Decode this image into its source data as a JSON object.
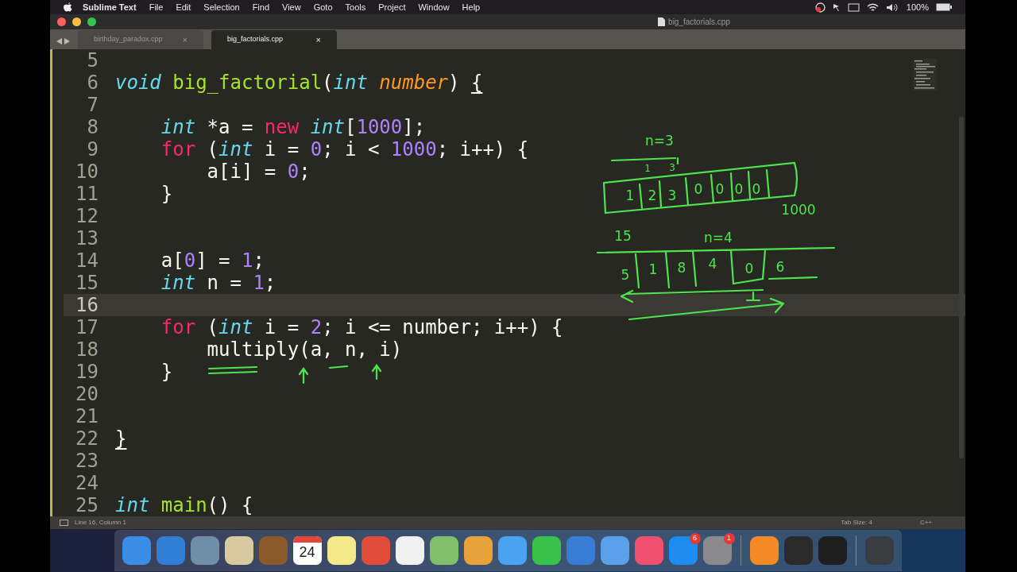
{
  "menu_bar": {
    "app": "Sublime Text",
    "items": [
      "File",
      "Edit",
      "Selection",
      "Find",
      "View",
      "Goto",
      "Tools",
      "Project",
      "Window",
      "Help"
    ],
    "battery": "100%"
  },
  "window": {
    "title": "big_factorials.cpp"
  },
  "tabs": [
    {
      "label": "birthday_paradox.cpp",
      "selected": false,
      "close": "×"
    },
    {
      "label": "big_factorials.cpp",
      "selected": true,
      "close": "×"
    }
  ],
  "editor": {
    "lines": [
      {
        "number": "5",
        "current": false
      },
      {
        "number": "6",
        "current": false,
        "tokens": [
          {
            "kind": "type",
            "text": "void"
          },
          {
            "kind": "func",
            "text": " big_factorial"
          },
          {
            "kind": "plain",
            "text": "("
          },
          {
            "kind": "type",
            "text": "int"
          },
          {
            "kind": "param",
            "text": " number"
          },
          {
            "kind": "plain",
            "text": ") "
          },
          {
            "kind": "bracket",
            "text": "{"
          }
        ]
      },
      {
        "number": "7",
        "current": false
      },
      {
        "number": "8",
        "current": false,
        "tokens": [
          {
            "kind": "type",
            "text": "    int"
          },
          {
            "kind": "plain",
            "text": " *a = "
          },
          {
            "kind": "keyword",
            "text": "new"
          },
          {
            "kind": "type",
            "text": " int"
          },
          {
            "kind": "plain",
            "text": "["
          },
          {
            "kind": "number",
            "text": "1000"
          },
          {
            "kind": "plain",
            "text": "];"
          }
        ]
      },
      {
        "number": "9",
        "current": false,
        "tokens": [
          {
            "kind": "keyword",
            "text": "    for"
          },
          {
            "kind": "plain",
            "text": " ("
          },
          {
            "kind": "type",
            "text": "int"
          },
          {
            "kind": "plain",
            "text": " i = "
          },
          {
            "kind": "number",
            "text": "0"
          },
          {
            "kind": "plain",
            "text": "; i < "
          },
          {
            "kind": "number",
            "text": "1000"
          },
          {
            "kind": "plain",
            "text": "; i++) {"
          }
        ]
      },
      {
        "number": "10",
        "current": false,
        "tokens": [
          {
            "kind": "plain",
            "text": "        a[i] = "
          },
          {
            "kind": "number",
            "text": "0"
          },
          {
            "kind": "plain",
            "text": ";"
          }
        ]
      },
      {
        "number": "11",
        "current": false,
        "tokens": [
          {
            "kind": "plain",
            "text": "    }"
          }
        ]
      },
      {
        "number": "12",
        "current": false
      },
      {
        "number": "13",
        "current": false
      },
      {
        "number": "14",
        "current": false,
        "tokens": [
          {
            "kind": "plain",
            "text": "    a["
          },
          {
            "kind": "number",
            "text": "0"
          },
          {
            "kind": "plain",
            "text": "] = "
          },
          {
            "kind": "number",
            "text": "1"
          },
          {
            "kind": "plain",
            "text": ";"
          }
        ]
      },
      {
        "number": "15",
        "current": false,
        "tokens": [
          {
            "kind": "type",
            "text": "    int"
          },
          {
            "kind": "plain",
            "text": " n = "
          },
          {
            "kind": "number",
            "text": "1"
          },
          {
            "kind": "plain",
            "text": ";"
          }
        ]
      },
      {
        "number": "16",
        "current": true
      },
      {
        "number": "17",
        "current": false,
        "tokens": [
          {
            "kind": "keyword",
            "text": "    for"
          },
          {
            "kind": "plain",
            "text": " ("
          },
          {
            "kind": "type",
            "text": "int"
          },
          {
            "kind": "plain",
            "text": " i = "
          },
          {
            "kind": "number",
            "text": "2"
          },
          {
            "kind": "plain",
            "text": "; i <= number; i++) {"
          }
        ]
      },
      {
        "number": "18",
        "current": false,
        "tokens": [
          {
            "kind": "plain",
            "text": "        multiply(a, n, i)"
          }
        ]
      },
      {
        "number": "19",
        "current": false,
        "tokens": [
          {
            "kind": "plain",
            "text": "    }"
          }
        ]
      },
      {
        "number": "20",
        "current": false
      },
      {
        "number": "21",
        "current": false
      },
      {
        "number": "22",
        "current": false,
        "tokens": [
          {
            "kind": "bracket",
            "text": "}"
          }
        ]
      },
      {
        "number": "23",
        "current": false
      },
      {
        "number": "24",
        "current": false
      },
      {
        "number": "25",
        "current": false,
        "tokens": [
          {
            "kind": "type",
            "text": "int"
          },
          {
            "kind": "func",
            "text": " main"
          },
          {
            "kind": "plain",
            "text": "() {"
          }
        ]
      }
    ]
  },
  "annotations": {
    "labels": [
      "n=3",
      "1",
      "3",
      "1",
      "2",
      "3",
      "0",
      "0",
      "0",
      "0",
      "1000",
      "15",
      "n=4",
      "5",
      "1",
      "8",
      "4",
      "0",
      "6"
    ]
  },
  "status_bar": {
    "position": "Line 16, Column 1",
    "tab_size": "Tab Size: 4",
    "syntax": "C++"
  },
  "dock": [
    {
      "kind": "app",
      "color": "#3b8ee8"
    },
    {
      "kind": "app",
      "color": "#2f7fd6"
    },
    {
      "kind": "app",
      "color": "#6f8fa8"
    },
    {
      "kind": "app",
      "color": "#d8c9a0"
    },
    {
      "kind": "app",
      "color": "#8a5a2b"
    },
    {
      "kind": "calendar",
      "color": "#ffffff",
      "text": "24"
    },
    {
      "kind": "app",
      "color": "#f4e98a"
    },
    {
      "kind": "app",
      "color": "#e04b3a"
    },
    {
      "kind": "app",
      "color": "#f1f1f1"
    },
    {
      "kind": "app",
      "color": "#7fbf6a"
    },
    {
      "kind": "app",
      "color": "#e8a23a"
    },
    {
      "kind": "app",
      "color": "#4aa3f0"
    },
    {
      "kind": "app",
      "color": "#38c24a"
    },
    {
      "kind": "app",
      "color": "#3a7bd5"
    },
    {
      "kind": "app",
      "color": "#5aa0e8"
    },
    {
      "kind": "app",
      "color": "#f0506e"
    },
    {
      "kind": "app",
      "color": "#1d8cf0",
      "badge": "6"
    },
    {
      "kind": "app",
      "color": "#8a8a8e",
      "badge": "1"
    },
    {
      "kind": "separator",
      "color": "#888888"
    },
    {
      "kind": "app",
      "color": "#f48a24"
    },
    {
      "kind": "app",
      "color": "#2a2a2a"
    },
    {
      "kind": "app",
      "color": "#1e1e1e"
    },
    {
      "kind": "separator",
      "color": "#888888"
    },
    {
      "kind": "app",
      "color": "#3a3d40"
    }
  ]
}
